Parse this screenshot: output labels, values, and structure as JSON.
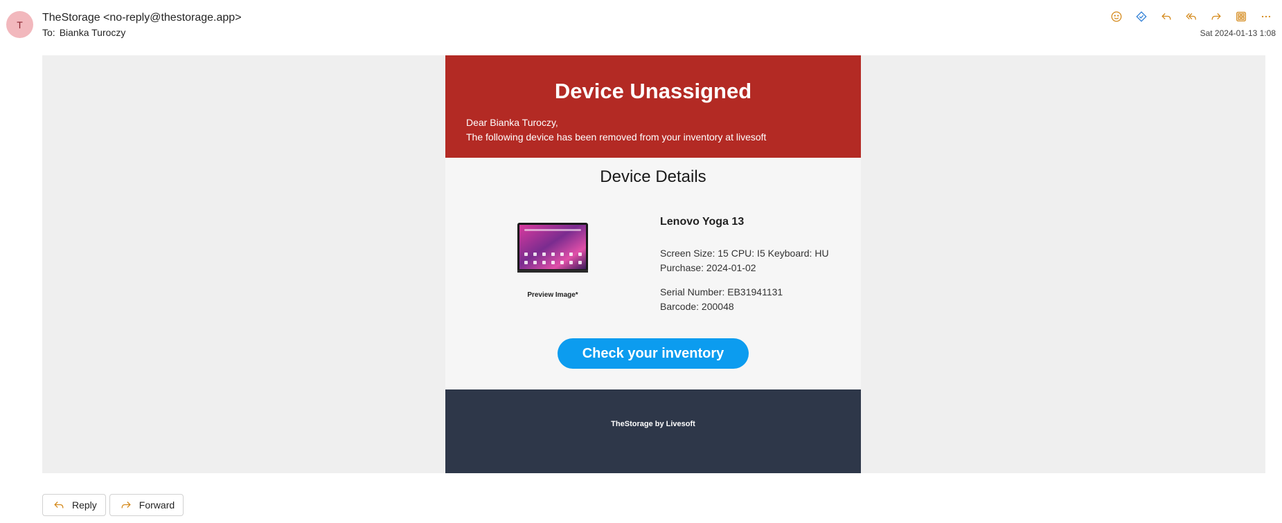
{
  "header": {
    "avatar_initial": "T",
    "sender": "TheStorage <no-reply@thestorage.app>",
    "to_label": "To:",
    "to_name": "Bianka Turoczy",
    "date": "Sat 2024-01-13 1:08",
    "toolbar_icons": [
      "smiley-icon",
      "tag-icon",
      "reply-icon",
      "reply-all-icon",
      "forward-icon",
      "apps-icon",
      "more-icon"
    ],
    "accent_color": "#d4891a"
  },
  "email": {
    "banner_title": "Device Unassigned",
    "greeting": "Dear Bianka Turoczy,",
    "message": "The following device has been removed from your inventory at livesoft",
    "banner_color": "#b32a24",
    "details_title": "Device Details",
    "preview_caption": "Preview Image*",
    "device_name": "Lenovo Yoga 13",
    "specs": "Screen Size: 15 CPU: I5 Keyboard: HU",
    "purchase": "Purchase: 2024-01-02",
    "serial": "Serial Number: EB31941131",
    "barcode": "Barcode: 200048",
    "cta_label": "Check your inventory",
    "cta_color": "#0c9cef",
    "footer_brand": "TheStorage by Livesoft",
    "footer_color": "#2e3749"
  },
  "actions": {
    "reply_label": "Reply",
    "forward_label": "Forward"
  }
}
